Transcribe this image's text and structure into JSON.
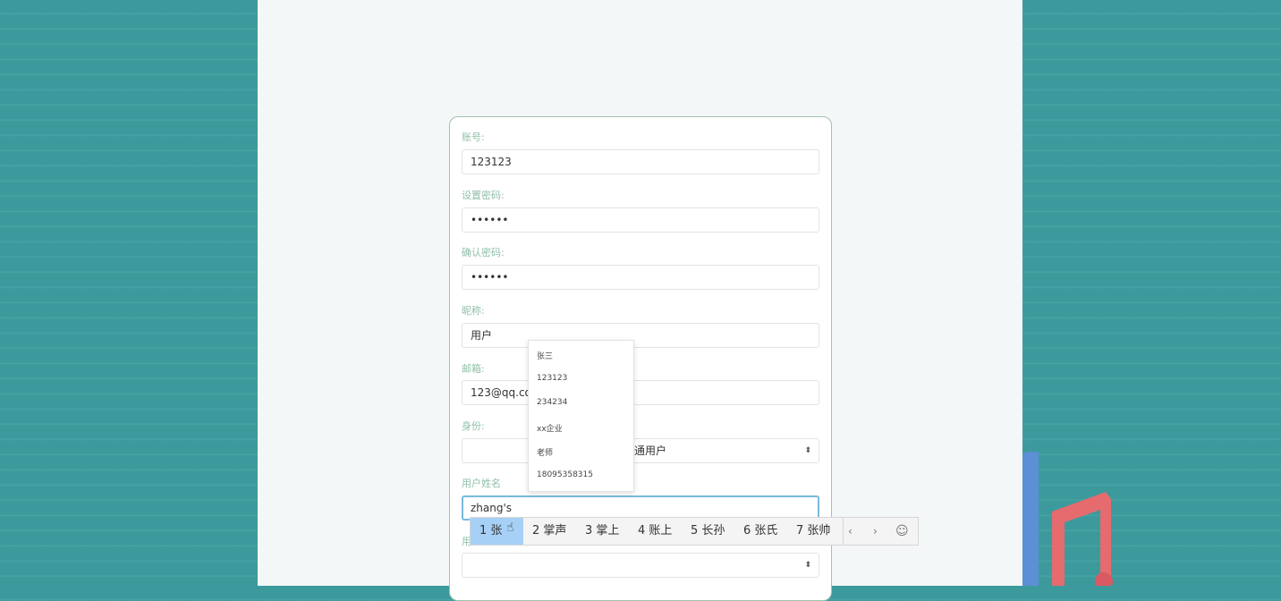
{
  "form": {
    "account_label": "账号:",
    "account_value": "123123",
    "password_label": "设置密码:",
    "password_value": "••••••",
    "confirm_label": "确认密码:",
    "confirm_value": "••••••",
    "nickname_label": "昵称:",
    "nickname_value": "用户",
    "email_label": "邮箱:",
    "email_value": "123@qq.co",
    "identity_label": "身份:",
    "identity_value": "通用户",
    "realname_label": "用户姓名",
    "realname_value": "zhang's",
    "next_label": "用"
  },
  "autocomplete": {
    "items": [
      "张三",
      "123123",
      "234234",
      "xx企业",
      "老师",
      "18095358315"
    ]
  },
  "ime": {
    "candidates": [
      "1 张",
      "2 掌声",
      "3 掌上",
      "4 账上",
      "5 长孙",
      "6 张氏",
      "7 张帅"
    ],
    "prev": "‹",
    "next": "›",
    "emoji": "☺"
  }
}
